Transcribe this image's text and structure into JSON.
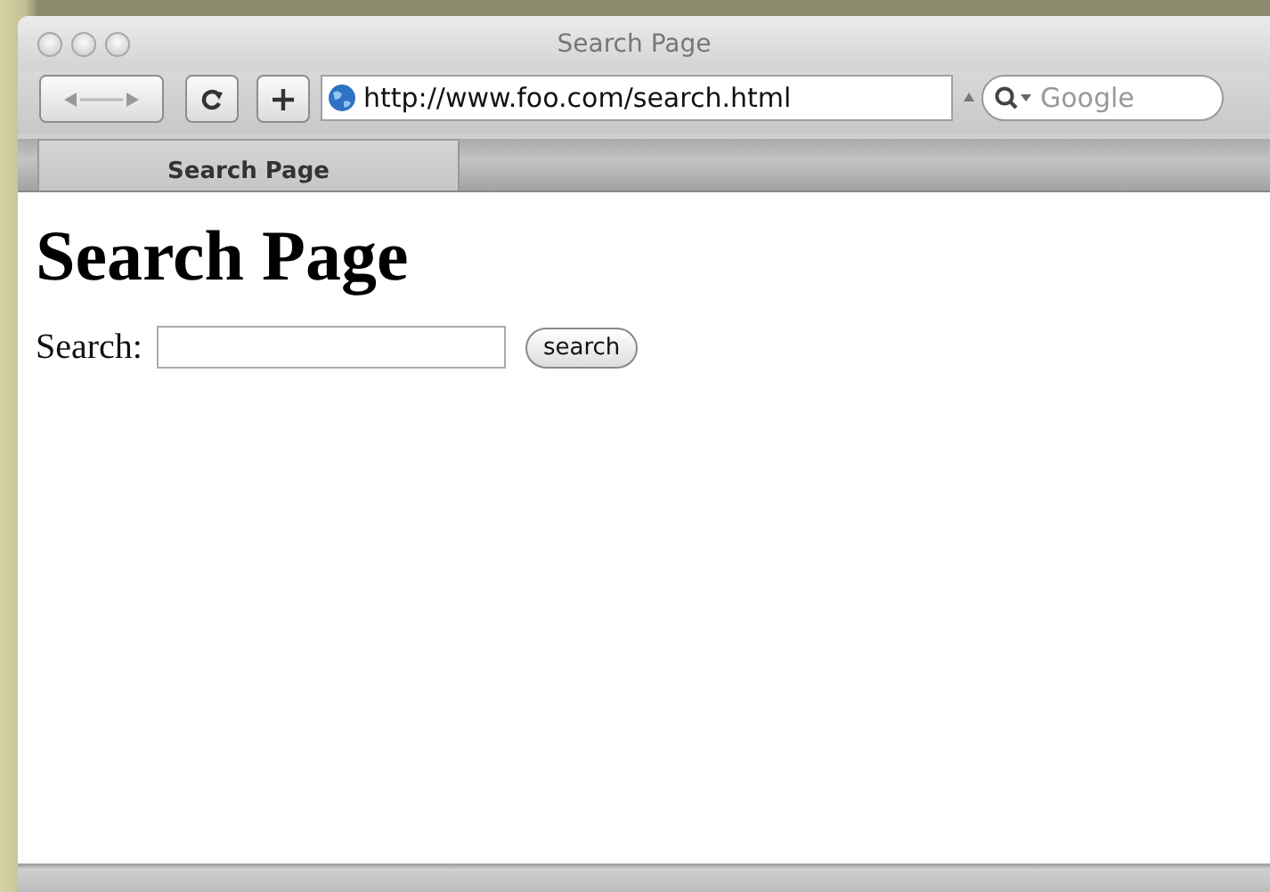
{
  "window": {
    "title": "Search Page"
  },
  "toolbar": {
    "url": "http://www.foo.com/search.html",
    "search": {
      "placeholder": "Google"
    }
  },
  "tabs": [
    {
      "label": "Search Page",
      "selected": true
    }
  ],
  "page": {
    "heading": "Search Page",
    "search_label": "Search:",
    "button": "search"
  }
}
